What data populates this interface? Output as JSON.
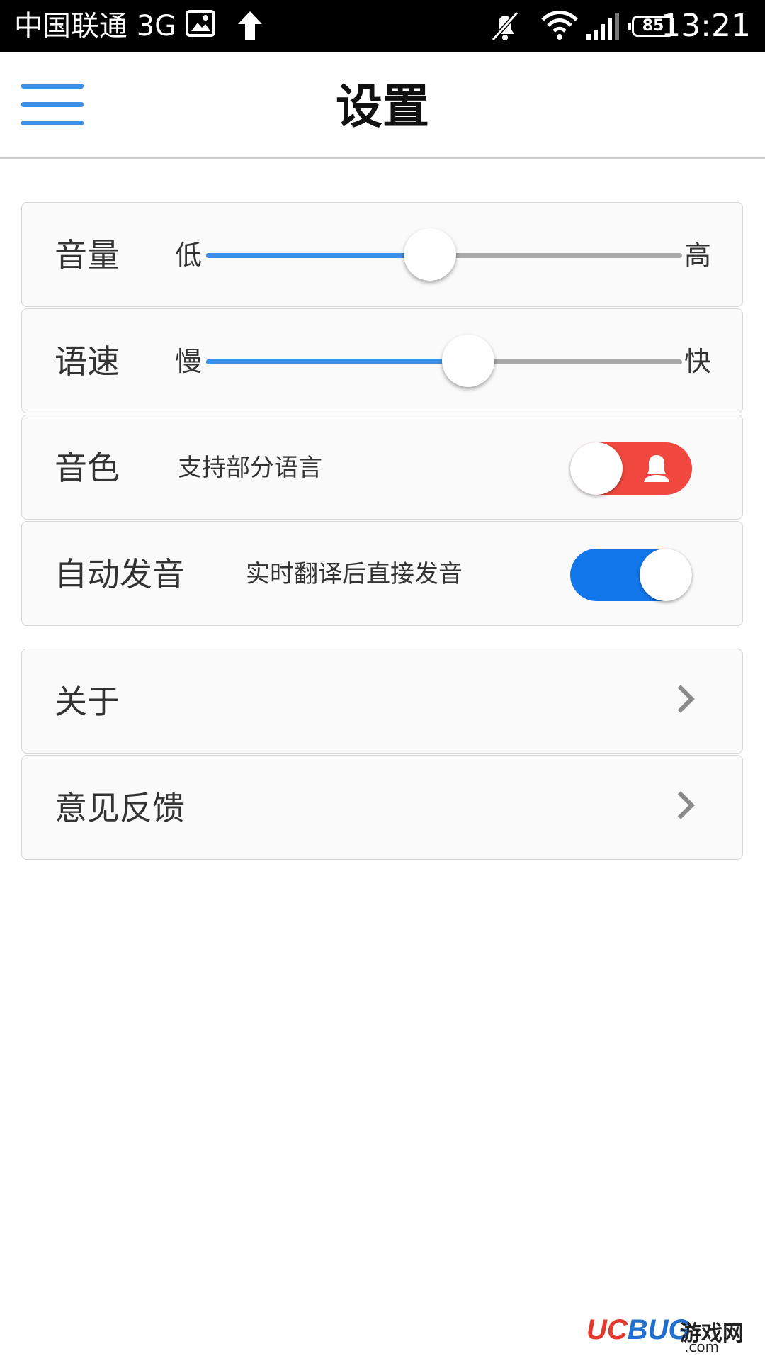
{
  "status_bar": {
    "carrier": "中国联通 3G",
    "battery": "85",
    "time": "13:21"
  },
  "header": {
    "title": "设置",
    "menu_icon": "hamburger-menu-icon"
  },
  "settings": {
    "volume": {
      "label": "音量",
      "min_label": "低",
      "max_label": "高",
      "value_fraction": 0.47
    },
    "speed": {
      "label": "语速",
      "min_label": "慢",
      "max_label": "快",
      "value_fraction": 0.55
    },
    "voice": {
      "label": "音色",
      "description": "支持部分语言",
      "toggle_color": "#f0483e",
      "toggle_icon": "female-person-icon"
    },
    "auto_speak": {
      "label": "自动发音",
      "description": "实时翻译后直接发音",
      "enabled": true,
      "toggle_color": "#1277ea"
    }
  },
  "links": {
    "about": {
      "label": "关于"
    },
    "feedback": {
      "label": "意见反馈"
    }
  },
  "watermark": {
    "logo_red": "UC",
    "logo_blue": "BUG",
    "site_name": "游戏网",
    "domain": ".com"
  },
  "colors": {
    "accent": "#3b8fe6",
    "track_inactive": "#a9a9a9"
  }
}
